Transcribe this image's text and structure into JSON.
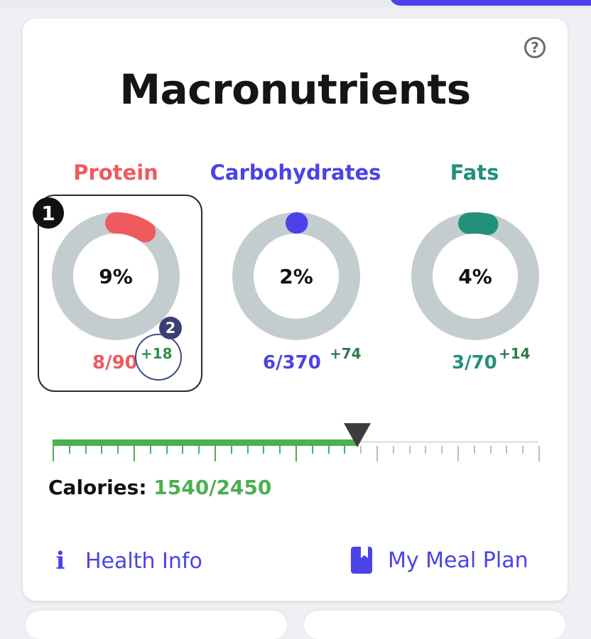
{
  "title": "Macronutrients",
  "colors": {
    "protein": "#ef5a5f",
    "carbs": "#4b43e8",
    "fats": "#23907c",
    "ring_track": "#c3cdd0",
    "calories_green": "#4caf50",
    "link": "#4b43e8"
  },
  "macros": [
    {
      "name": "Protein",
      "percent": "9%",
      "amount": "8/90",
      "delta": "+18",
      "fill_fraction": 0.09
    },
    {
      "name": "Carbohydrates",
      "percent": "2%",
      "amount": "6/370",
      "delta": "+74",
      "fill_fraction": 0.02
    },
    {
      "name": "Fats",
      "percent": "4%",
      "amount": "3/70",
      "delta": "+14",
      "fill_fraction": 0.04
    }
  ],
  "annotations": {
    "marker_1": "1",
    "marker_2": "2"
  },
  "calories": {
    "label": "Calories:",
    "value": "1540/2450",
    "fill_fraction": 0.63
  },
  "links": {
    "health_info": "Health Info",
    "meal_plan": "My Meal Plan"
  },
  "icons": {
    "help": "question-circle-icon",
    "info": "info-icon",
    "meal_plan": "book-icon"
  }
}
